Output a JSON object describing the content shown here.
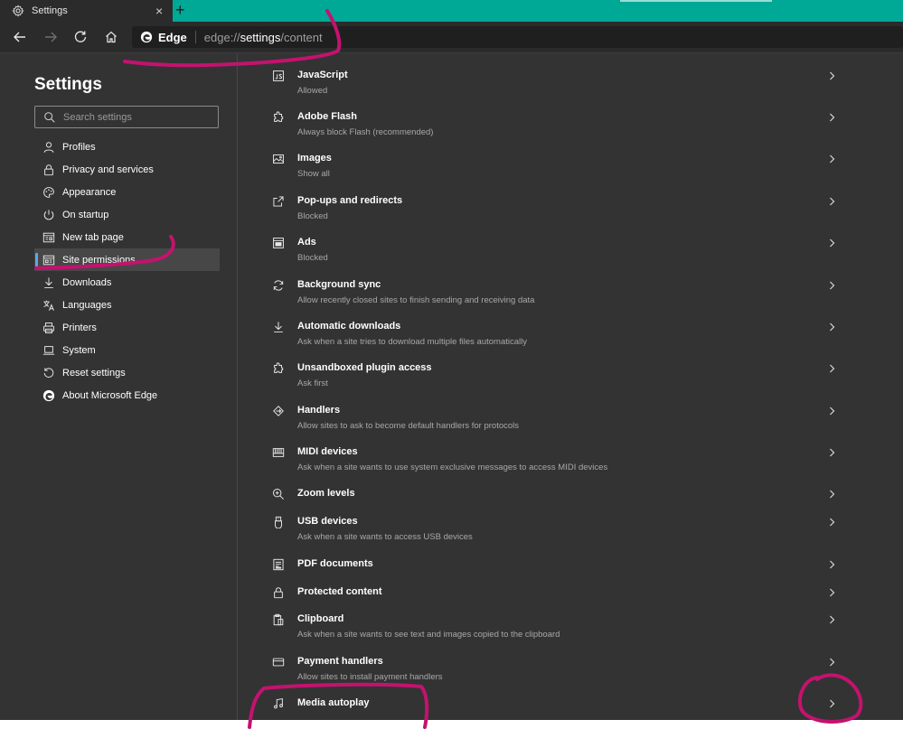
{
  "tab": {
    "title": "Settings",
    "close": "×",
    "new_tab": "+"
  },
  "address": {
    "brand": "Edge",
    "url_prefix": "edge://",
    "url_bold": "settings",
    "url_suffix": "/content"
  },
  "sidebar": {
    "title": "Settings",
    "search_placeholder": "Search settings",
    "items": [
      {
        "label": "Profiles",
        "icon": "person-icon"
      },
      {
        "label": "Privacy and services",
        "icon": "lock-icon"
      },
      {
        "label": "Appearance",
        "icon": "palette-icon"
      },
      {
        "label": "On startup",
        "icon": "power-icon"
      },
      {
        "label": "New tab page",
        "icon": "newtab-icon"
      },
      {
        "label": "Site permissions",
        "icon": "site-permissions-icon",
        "active": true
      },
      {
        "label": "Downloads",
        "icon": "download-icon"
      },
      {
        "label": "Languages",
        "icon": "languages-icon"
      },
      {
        "label": "Printers",
        "icon": "printer-icon"
      },
      {
        "label": "System",
        "icon": "laptop-icon"
      },
      {
        "label": "Reset settings",
        "icon": "reset-icon"
      },
      {
        "label": "About Microsoft Edge",
        "icon": "edge-logo-icon"
      }
    ]
  },
  "permissions": [
    {
      "title": "JavaScript",
      "subtitle": "Allowed",
      "icon": "javascript-icon"
    },
    {
      "title": "Adobe Flash",
      "subtitle": "Always block Flash (recommended)",
      "icon": "puzzle-icon"
    },
    {
      "title": "Images",
      "subtitle": "Show all",
      "icon": "image-icon"
    },
    {
      "title": "Pop-ups and redirects",
      "subtitle": "Blocked",
      "icon": "popup-icon"
    },
    {
      "title": "Ads",
      "subtitle": "Blocked",
      "icon": "ads-icon"
    },
    {
      "title": "Background sync",
      "subtitle": "Allow recently closed sites to finish sending and receiving data",
      "icon": "sync-icon"
    },
    {
      "title": "Automatic downloads",
      "subtitle": "Ask when a site tries to download multiple files automatically",
      "icon": "download-icon"
    },
    {
      "title": "Unsandboxed plugin access",
      "subtitle": "Ask first",
      "icon": "puzzle-icon"
    },
    {
      "title": "Handlers",
      "subtitle": "Allow sites to ask to become default handlers for protocols",
      "icon": "handlers-icon"
    },
    {
      "title": "MIDI devices",
      "subtitle": "Ask when a site wants to use system exclusive messages to access MIDI devices",
      "icon": "midi-icon"
    },
    {
      "title": "Zoom levels",
      "subtitle": "",
      "icon": "zoom-icon"
    },
    {
      "title": "USB devices",
      "subtitle": "Ask when a site wants to access USB devices",
      "icon": "usb-icon"
    },
    {
      "title": "PDF documents",
      "subtitle": "",
      "icon": "pdf-icon"
    },
    {
      "title": "Protected content",
      "subtitle": "",
      "icon": "lock-icon"
    },
    {
      "title": "Clipboard",
      "subtitle": "Ask when a site wants to see text and images copied to the clipboard",
      "icon": "clipboard-icon"
    },
    {
      "title": "Payment handlers",
      "subtitle": "Allow sites to install payment handlers",
      "icon": "card-icon"
    },
    {
      "title": "Media autoplay",
      "subtitle": "",
      "icon": "music-icon"
    }
  ],
  "colors": {
    "accent": "#5ea7e6",
    "titlebar": "#00a896",
    "ink": "#c4126f"
  }
}
